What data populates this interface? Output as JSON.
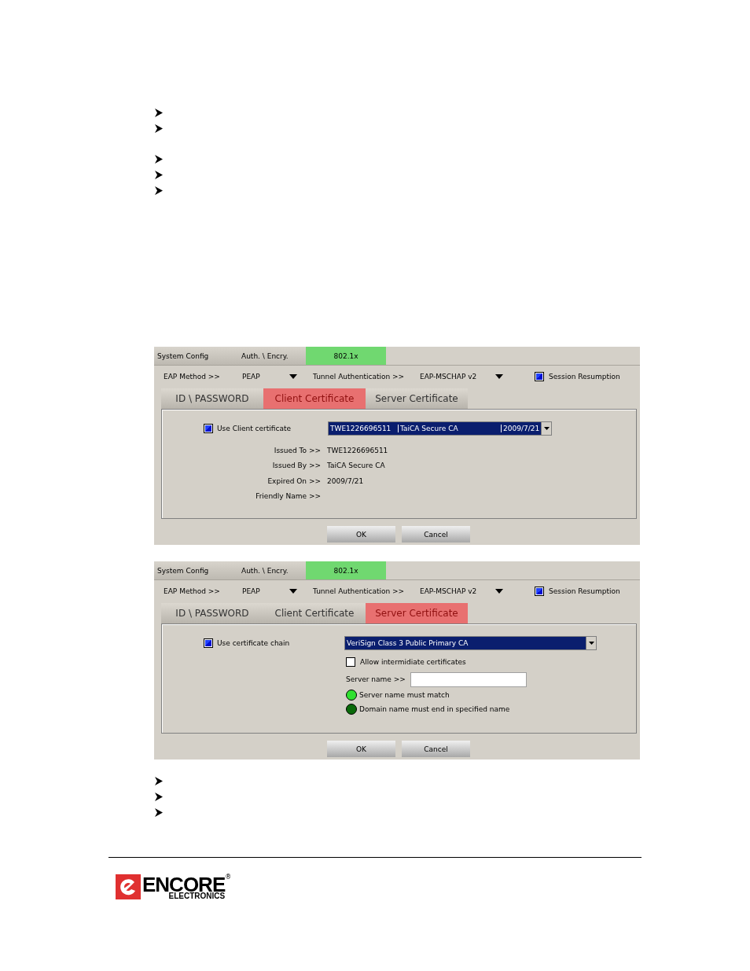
{
  "dialogs": [
    {
      "kind": "client",
      "top_tabs": [
        {
          "label": "System Config",
          "selected": false
        },
        {
          "label": "Auth. \\ Encry.",
          "selected": false
        },
        {
          "label": "802.1x",
          "selected": true
        }
      ],
      "eap_label": "EAP Method >>",
      "eap_value": "PEAP",
      "tunnel_label": "Tunnel Authentication >>",
      "tunnel_value": "EAP-MSCHAP v2",
      "session": {
        "label": "Session Resumption",
        "checked": true
      },
      "sub_tabs": [
        {
          "label": "ID \\ PASSWORD",
          "selected": false
        },
        {
          "label": "Client Certificate",
          "selected": true
        },
        {
          "label": "Server Certificate",
          "selected": false
        }
      ],
      "use_cert": {
        "label": "Use Client certificate",
        "checked": true
      },
      "cert_select": [
        "TWE1226696511",
        "TaiCA Secure CA",
        "2009/7/21"
      ],
      "details": [
        {
          "label": "Issued To >>",
          "value": "TWE1226696511"
        },
        {
          "label": "Issued By >>",
          "value": "TaiCA Secure CA"
        },
        {
          "label": "Expired On >>",
          "value": "2009/7/21"
        },
        {
          "label": "Friendly Name >>"
        }
      ],
      "buttons": [
        "OK",
        "Cancel"
      ]
    },
    {
      "kind": "server",
      "top_tabs": [
        {
          "label": "System Config",
          "selected": false
        },
        {
          "label": "Auth. \\ Encry.",
          "selected": false
        },
        {
          "label": "802.1x",
          "selected": true
        }
      ],
      "eap_label": "EAP Method >>",
      "eap_value": "PEAP",
      "tunnel_label": "Tunnel Authentication >>",
      "tunnel_value": "EAP-MSCHAP v2",
      "session": {
        "label": "Session Resumption",
        "checked": true
      },
      "sub_tabs": [
        {
          "label": "ID \\ PASSWORD",
          "selected": false
        },
        {
          "label": "Client Certificate",
          "selected": false
        },
        {
          "label": "Server Certificate",
          "selected": true
        }
      ],
      "use_chain": {
        "label": "Use certificate chain",
        "checked": true
      },
      "ca_select": "VeriSign Class 3 Public Primary CA",
      "allow_intermediate": {
        "label": "Allow intermidiate certificates",
        "checked": false
      },
      "server_name_label": "Server name >>",
      "options": [
        {
          "label": "Server name must match",
          "on": true
        },
        {
          "label": "Domain name must end in specified name",
          "on": false
        }
      ],
      "buttons": [
        "OK",
        "Cancel"
      ]
    }
  ],
  "logo": {
    "name": "ENCORE",
    "sub": "ELECTRONICS",
    "mark": "®"
  }
}
